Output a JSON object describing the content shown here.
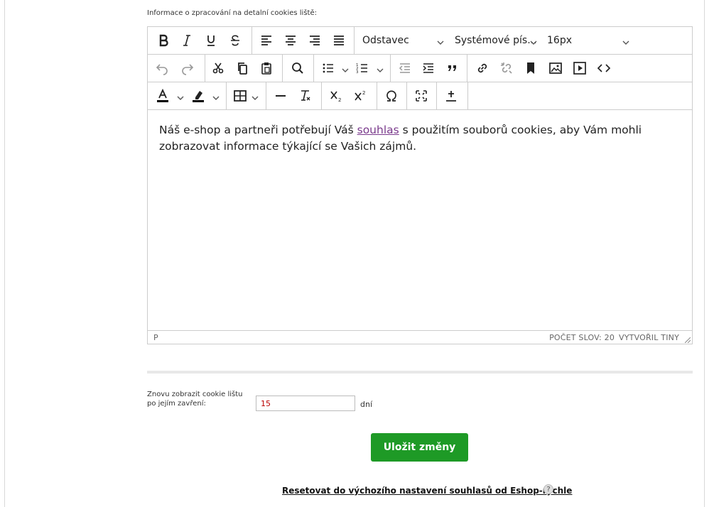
{
  "field_label": "Informace o zpracování na detalní cookies liště:",
  "toolbar": {
    "block_format": "Odstavec",
    "font_family": "Systémové pís...",
    "font_size": "16px"
  },
  "content": {
    "before_link": "Náš e-shop a partneři potřebují Váš ",
    "link": "souhlas",
    "after_link": " s použitím souborů cookies, aby Vám mohli zobrazovat informace týkající se Vašich zájmů."
  },
  "statusbar": {
    "path": "P",
    "word_count": "POČET SLOV: 20",
    "credit": "VYTVOŘIL TINY"
  },
  "reshow": {
    "label": "Znovu zobrazit cookie lištu po jejím zavření:",
    "value": "15",
    "unit": "dní"
  },
  "save_label": "Uložit změny",
  "reset_label": "Resetovat do výchozího nastavení souhlasů od Eshop-rychle",
  "help_label": "?",
  "colors": {
    "save_button": "#1e9a26",
    "link": "#7a3a8c"
  }
}
